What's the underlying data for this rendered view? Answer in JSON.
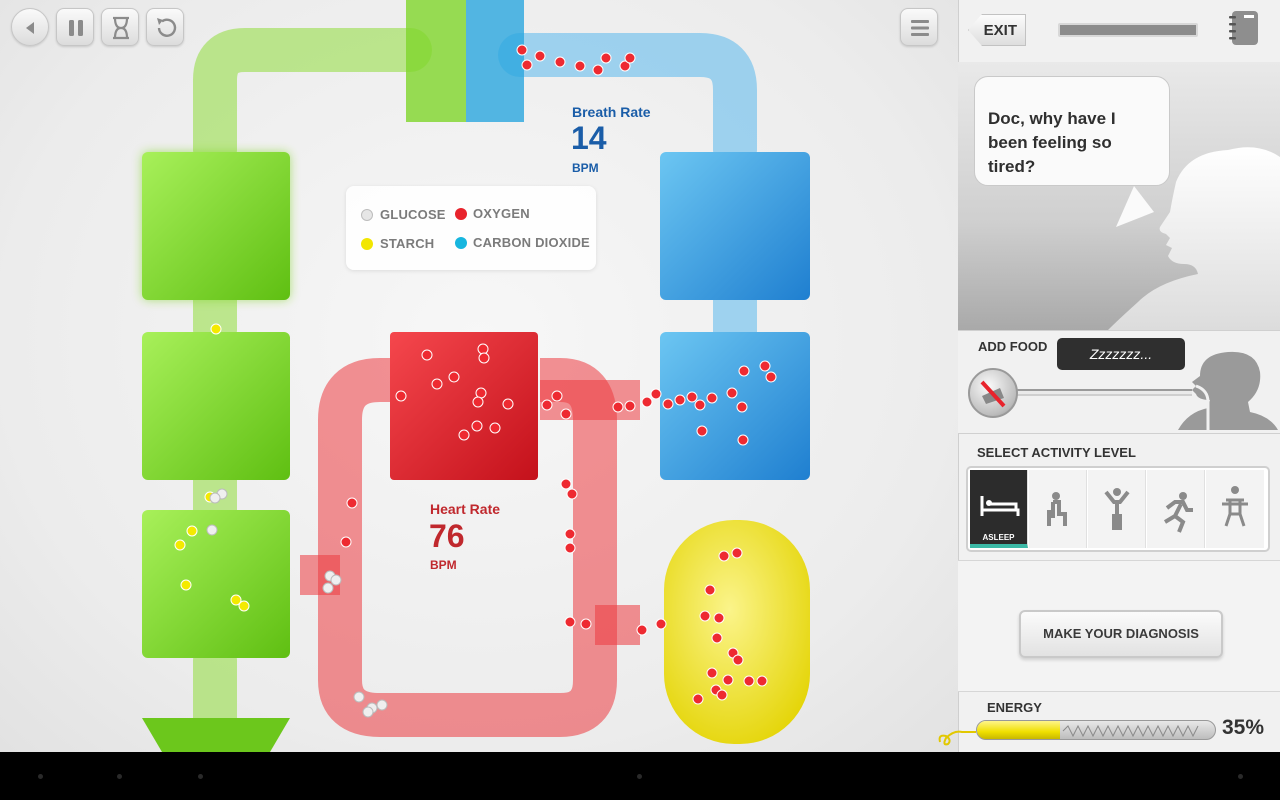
{
  "colors": {
    "digestive": "#7ed321",
    "lungs": "#3aa8e0",
    "heart": "#e8232c",
    "muscle": "#eee234",
    "breath_text": "#1a5da8",
    "heart_text": "#c0282d",
    "accent": "#3bb9a6"
  },
  "toolbar": {
    "back_icon": "back-triangle-icon",
    "pause_icon": "pause-icon",
    "time_icon": "hourglass-icon",
    "reset_icon": "undo-icon",
    "menu_icon": "menu-lines-icon"
  },
  "legend": {
    "items": [
      {
        "label": "GLUCOSE",
        "color": "#e6e6e6"
      },
      {
        "label": "OXYGEN",
        "color": "#e8232c"
      },
      {
        "label": "STARCH",
        "color": "#f2e600"
      },
      {
        "label": "CARBON DIOXIDE",
        "color": "#17b6df"
      }
    ]
  },
  "breath": {
    "label": "Breath Rate",
    "value": "14",
    "unit": "BPM"
  },
  "heart": {
    "label": "Heart Rate",
    "value": "76",
    "unit": "BPM"
  },
  "panel": {
    "exit_label": "EXIT",
    "notebook_icon": "notebook-icon",
    "speech": "Doc, why have I been feeling so tired?",
    "add_food_label": "ADD FOOD",
    "food_bubble": "Zzzzzzz...",
    "activity_title": "SELECT ACTIVITY LEVEL",
    "activities": [
      {
        "name": "asleep",
        "label": "ASLEEP",
        "icon": "bed-icon",
        "selected": true
      },
      {
        "name": "sitting",
        "label": "",
        "icon": "sitting-icon",
        "selected": false
      },
      {
        "name": "standing",
        "label": "",
        "icon": "standing-icon",
        "selected": false
      },
      {
        "name": "running",
        "label": "",
        "icon": "running-icon",
        "selected": false
      },
      {
        "name": "lifting",
        "label": "",
        "icon": "lifting-icon",
        "selected": false
      }
    ],
    "diagnosis_label": "MAKE YOUR DIAGNOSIS",
    "energy_label": "ENERGY",
    "energy_value": 0.35,
    "energy_text": "35%"
  }
}
